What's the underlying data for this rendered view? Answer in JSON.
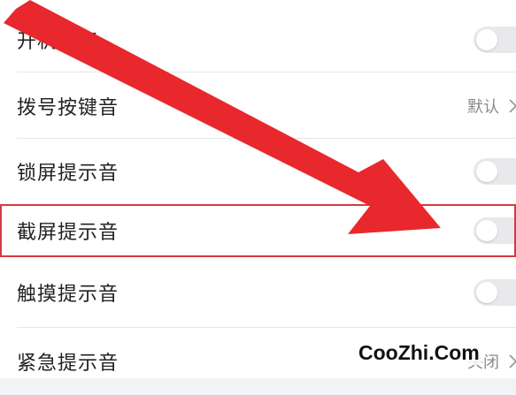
{
  "settings": {
    "items": [
      {
        "label": "开机铃声",
        "control": "toggle",
        "on": false
      },
      {
        "label": "拨号按键音",
        "control": "value",
        "value": "默认"
      },
      {
        "label": "锁屏提示音",
        "control": "toggle",
        "on": false
      },
      {
        "label": "截屏提示音",
        "control": "toggle",
        "on": false,
        "highlighted": true
      },
      {
        "label": "触摸提示音",
        "control": "toggle",
        "on": false
      },
      {
        "label": "紧急提示音",
        "control": "value",
        "value": "关闭"
      }
    ]
  },
  "icons": {
    "chevron": "chevron-right-icon",
    "arrow": "red-arrow-annotation-icon"
  },
  "colors": {
    "highlight": "#d23a45",
    "arrow": "#e8282d",
    "toggle_off": "#e9e9ec"
  },
  "watermark": {
    "text": "CooZhi.Com"
  }
}
